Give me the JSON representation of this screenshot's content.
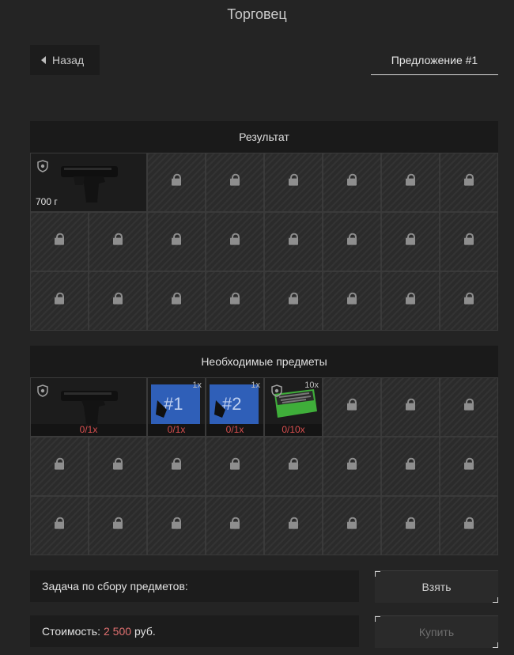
{
  "header": {
    "title": "Торговец"
  },
  "nav": {
    "back_label": "Назад",
    "offer_tab": "Предложение #1"
  },
  "result": {
    "title": "Результат",
    "item": {
      "name": "pistol",
      "weight": "700 г"
    }
  },
  "required": {
    "title": "Необходимые предметы",
    "items": [
      {
        "name": "pistol",
        "top_qty": "",
        "need": "0/1x"
      },
      {
        "name": "tag-1",
        "top_qty": "1x",
        "label": "#1",
        "need": "0/1x"
      },
      {
        "name": "tag-2",
        "top_qty": "1x",
        "label": "#2",
        "need": "0/1x"
      },
      {
        "name": "crate",
        "top_qty": "10x",
        "need": "0/10x"
      }
    ]
  },
  "task": {
    "label": "Задача по сбору предметов:"
  },
  "cost": {
    "label": "Стоимость:",
    "amount": "2 500",
    "currency": "руб."
  },
  "buttons": {
    "take": "Взять",
    "buy": "Купить"
  },
  "colors": {
    "price": "#e07070",
    "need": "#d94f4f",
    "tag_blue": "#2f5fb8",
    "crate_green": "#3fae3a"
  }
}
